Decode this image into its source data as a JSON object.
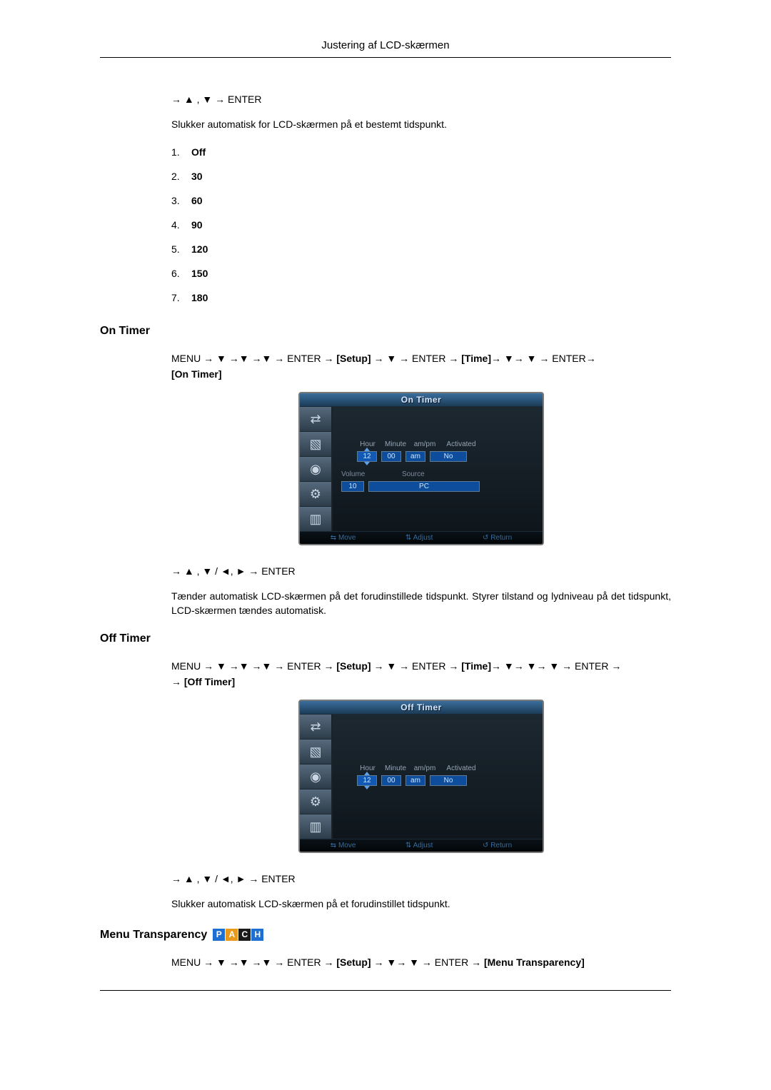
{
  "header": {
    "title": "Justering af LCD-skærmen"
  },
  "first": {
    "nav": "→ ▲ , ▼ → ENTER",
    "desc": "Slukker automatisk for LCD-skærmen på et bestemt tidspunkt.",
    "items": [
      {
        "n": "1.",
        "v": "Off"
      },
      {
        "n": "2.",
        "v": "30"
      },
      {
        "n": "3.",
        "v": "60"
      },
      {
        "n": "4.",
        "v": "90"
      },
      {
        "n": "5.",
        "v": "120"
      },
      {
        "n": "6.",
        "v": "150"
      },
      {
        "n": "7.",
        "v": "180"
      }
    ]
  },
  "onTimer": {
    "heading": "On Timer",
    "path_pre": "MENU → ▼ →▼ →▼ → ENTER → ",
    "setup": "[Setup]",
    "path_mid1": " → ▼ → ENTER → ",
    "time": "[Time]",
    "path_mid2": "→ ▼→ ▼ → ENTER→ ",
    "bracket": "[On Timer]",
    "nav2": "→ ▲ , ▼ / ◄, ► → ENTER",
    "desc": "Tænder automatisk LCD-skærmen på det forudinstillede tidspunkt. Styrer tilstand og lydniveau på det tidspunkt, LCD-skærmen tændes automatisk."
  },
  "offTimer": {
    "heading": "Off Timer",
    "path_pre": "MENU → ▼ →▼ →▼ → ENTER → ",
    "setup": "[Setup]",
    "path_mid1": " → ▼ → ENTER → ",
    "time": "[Time]",
    "path_mid2": "→ ▼→ ▼→ ▼ → ENTER → ",
    "bracket": "[Off Timer]",
    "nav2": "→ ▲ , ▼ / ◄, ► → ENTER",
    "desc": "Slukker automatisk LCD-skærmen på et forudinstillet tidspunkt."
  },
  "menuTransparency": {
    "heading": "Menu Transparency",
    "path_pre": "MENU → ▼ →▼ →▼ → ENTER → ",
    "setup": "[Setup]",
    "path_mid1": " → ▼→ ▼ → ENTER → ",
    "target": "[Menu Transparency]"
  },
  "osd1": {
    "title": "On Timer",
    "labels": {
      "hour": "Hour",
      "minute": "Minute",
      "ampm": "am/pm",
      "activated": "Activated"
    },
    "hour": "12",
    "minute": "00",
    "ampm": "am",
    "activated": "No",
    "sub": {
      "volumeLabel": "Volume",
      "sourceLabel": "Source"
    },
    "volume": "10",
    "source": "PC",
    "footer": {
      "move": "Move",
      "adjust": "Adjust",
      "return": "Return"
    }
  },
  "osd2": {
    "title": "Off Timer",
    "labels": {
      "hour": "Hour",
      "minute": "Minute",
      "ampm": "am/pm",
      "activated": "Activated"
    },
    "hour": "12",
    "minute": "00",
    "ampm": "am",
    "activated": "No",
    "footer": {
      "move": "Move",
      "adjust": "Adjust",
      "return": "Return"
    }
  },
  "badges": {
    "p": "P",
    "a": "A",
    "c": "C",
    "h": "H"
  }
}
